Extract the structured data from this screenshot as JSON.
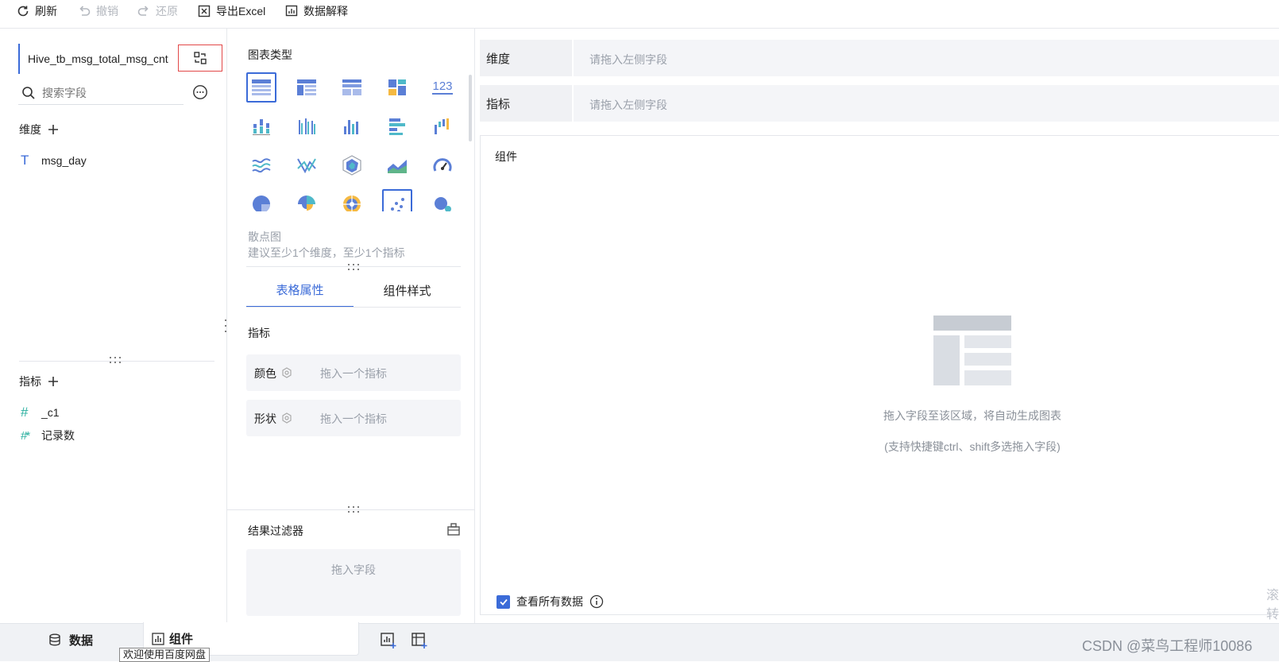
{
  "toolbar": {
    "refresh": "刷新",
    "undo": "撤销",
    "redo": "还原",
    "export": "导出Excel",
    "explain": "数据解释"
  },
  "left": {
    "dataset_name": "Hive_tb_msg_total_msg_cnt",
    "search_placeholder": "搜索字段",
    "dimension_title": "维度",
    "dimensions": [
      {
        "type_icon": "T",
        "name": "msg_day"
      }
    ],
    "metric_title": "指标",
    "metrics": [
      {
        "type_icon": "#",
        "name": "_c1"
      },
      {
        "type_icon": "#*",
        "name": "记录数"
      }
    ]
  },
  "middle": {
    "chart_type_title": "图表类型",
    "selected_chart_name": "散点图",
    "selected_chart_hint": "建议至少1个维度，至少1个指标",
    "tabs": [
      "表格属性",
      "组件样式"
    ],
    "active_tab": "表格属性",
    "metric_section": "指标",
    "color_label": "颜色",
    "color_placeholder": "拖入一个指标",
    "shape_label": "形状",
    "shape_placeholder": "拖入一个指标",
    "filter_title": "结果过滤器",
    "filter_placeholder": "拖入字段"
  },
  "right": {
    "dimension_label": "维度",
    "dimension_placeholder": "请拖入左侧字段",
    "metric_label": "指标",
    "metric_placeholder": "请拖入左侧字段",
    "component_title": "组件",
    "empty_hint": "拖入字段至该区域，将自动生成图表",
    "empty_sub_hint": "(支持快捷键ctrl、shift多选拖入字段)",
    "view_all_label": "查看所有数据",
    "view_all_checked": true,
    "edge_text": "滚转"
  },
  "bottom": {
    "data_tab": "数据",
    "component_tab": "组件",
    "tooltip": "欢迎使用百度网盘",
    "watermark": "CSDN @菜鸟工程师10086"
  },
  "colors": {
    "accent": "#3b6bd8",
    "chart_blue": "#5b7fd6",
    "chart_yellow": "#f5b942",
    "chart_teal": "#4fb9c9",
    "chart_green": "#5fb58a"
  }
}
